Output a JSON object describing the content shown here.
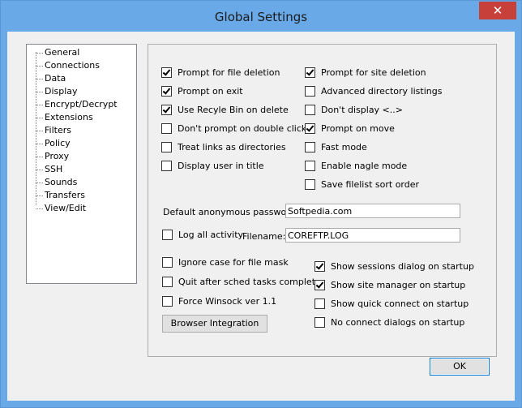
{
  "window": {
    "title": "Global Settings",
    "close_glyph": "✕"
  },
  "tree": {
    "items": [
      "General",
      "Connections",
      "Data",
      "Display",
      "Encrypt/Decrypt",
      "Extensions",
      "Filters",
      "Policy",
      "Proxy",
      "SSH",
      "Sounds",
      "Transfers",
      "View/Edit"
    ],
    "selected": "General"
  },
  "left_checks": [
    {
      "label": "Prompt for file deletion",
      "checked": true
    },
    {
      "label": "Prompt on exit",
      "checked": true
    },
    {
      "label": "Use Recyle Bin on delete",
      "checked": true
    },
    {
      "label": "Don't prompt on double click",
      "checked": false
    },
    {
      "label": "Treat links as directories",
      "checked": false
    },
    {
      "label": "Display user in title",
      "checked": false
    }
  ],
  "right_checks": [
    {
      "label": "Prompt for site deletion",
      "checked": true
    },
    {
      "label": "Advanced directory listings",
      "checked": false
    },
    {
      "label": "Don't display <..>",
      "checked": false
    },
    {
      "label": "Prompt on move",
      "checked": true
    },
    {
      "label": "Fast mode",
      "checked": false
    },
    {
      "label": "Enable nagle mode",
      "checked": false
    },
    {
      "label": "Save filelist sort order",
      "checked": false
    }
  ],
  "anon_password": {
    "label": "Default anonymous password:",
    "value": "Softpedia.com"
  },
  "log": {
    "label": "Log all activity",
    "checked": false,
    "filename_label": "Filename:",
    "filename_value": "COREFTP.LOG"
  },
  "bottom_left_checks": [
    {
      "label": "Ignore case for file mask",
      "checked": false
    },
    {
      "label": "Quit after sched tasks complete",
      "checked": false
    },
    {
      "label": "Force Winsock ver 1.1",
      "checked": false
    }
  ],
  "bottom_right_checks": [
    {
      "label": "Show sessions dialog on startup",
      "checked": true
    },
    {
      "label": "Show site manager on startup",
      "checked": true
    },
    {
      "label": "Show quick connect on startup",
      "checked": false
    },
    {
      "label": "No connect dialogs on startup",
      "checked": false
    }
  ],
  "buttons": {
    "browser_integration": "Browser Integration",
    "ok": "OK"
  }
}
